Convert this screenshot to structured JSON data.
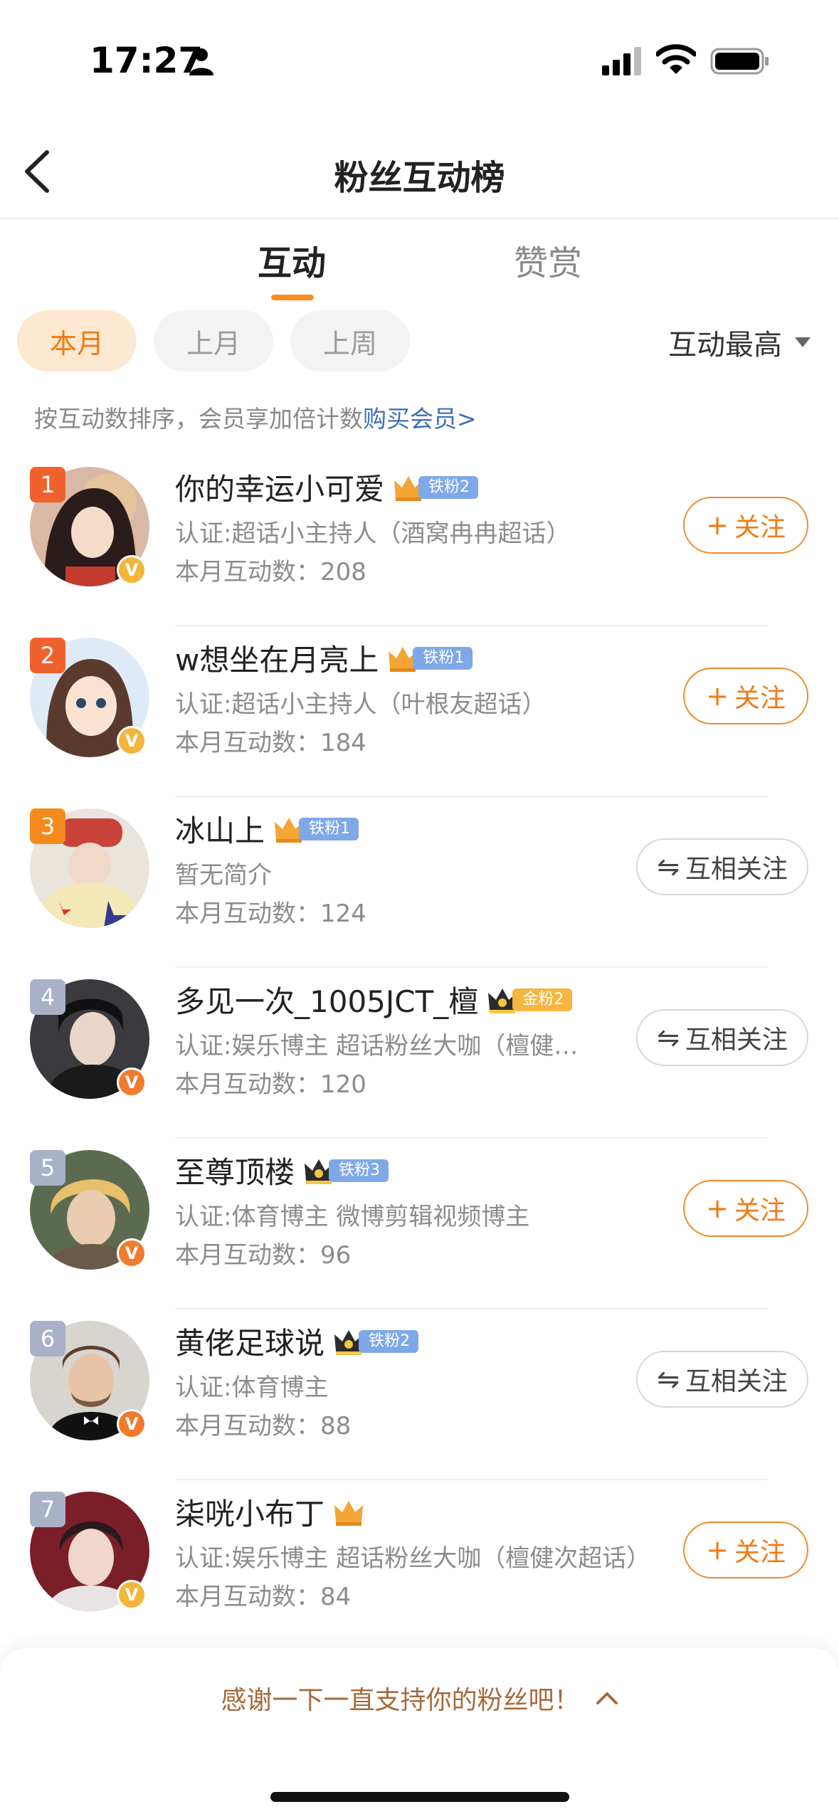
{
  "status": {
    "time": "17:27"
  },
  "nav": {
    "title": "粉丝互动榜"
  },
  "tabs": [
    {
      "label": "互动"
    },
    {
      "label": "赞赏"
    }
  ],
  "filters": {
    "chips": [
      {
        "label": "本月"
      },
      {
        "label": "上月"
      },
      {
        "label": "上周"
      }
    ],
    "sort": "互动最高"
  },
  "hint": {
    "text": "按互动数排序，会员享加倍计数",
    "link": "购买会员>"
  },
  "colors": {
    "accent": "#f07b14",
    "link": "#3b6fb6",
    "rank_top": "#f0622d",
    "rank_third": "#f58a1c",
    "rank_other": "#a9b1c7",
    "iron_fan": "#7fa8e8",
    "gold_fan": "#f4b63e"
  },
  "users": [
    {
      "rank": "1",
      "name": "你的幸运小可爱",
      "fan_badge": "铁粉2",
      "desc": "认证:超话小主持人（酒窝冉冉超话）",
      "count": "本月互动数：208",
      "button": "关注",
      "button_icon": "+"
    },
    {
      "rank": "2",
      "name": "w想坐在月亮上",
      "fan_badge": "铁粉1",
      "desc": "认证:超话小主持人（叶根友超话）",
      "count": "本月互动数：184",
      "button": "关注",
      "button_icon": "+"
    },
    {
      "rank": "3",
      "name": "冰山上",
      "fan_badge": "铁粉1",
      "desc": "暂无简介",
      "count": "本月互动数：124",
      "button": "互相关注",
      "button_icon": "⇋"
    },
    {
      "rank": "4",
      "name": "多见一次_1005JCT_檀",
      "fan_badge": "金粉2",
      "desc": "认证:娱乐博主 超话粉丝大咖（檀健次超话）",
      "count": "本月互动数：120",
      "button": "互相关注",
      "button_icon": "⇋"
    },
    {
      "rank": "5",
      "name": "至尊顶楼",
      "fan_badge": "铁粉3",
      "desc": "认证:体育博主 微博剪辑视频博主",
      "count": "本月互动数：96",
      "button": "关注",
      "button_icon": "+"
    },
    {
      "rank": "6",
      "name": "黄佬足球说",
      "fan_badge": "铁粉2",
      "desc": "认证:体育博主",
      "count": "本月互动数：88",
      "button": "互相关注",
      "button_icon": "⇋"
    },
    {
      "rank": "7",
      "name": "柒咣小布丁",
      "fan_badge": "",
      "desc": "认证:娱乐博主 超话粉丝大咖（檀健次超话）",
      "count": "本月互动数：84",
      "button": "关注",
      "button_icon": "+"
    }
  ],
  "footer": {
    "text": "感谢一下一直支持你的粉丝吧！"
  }
}
